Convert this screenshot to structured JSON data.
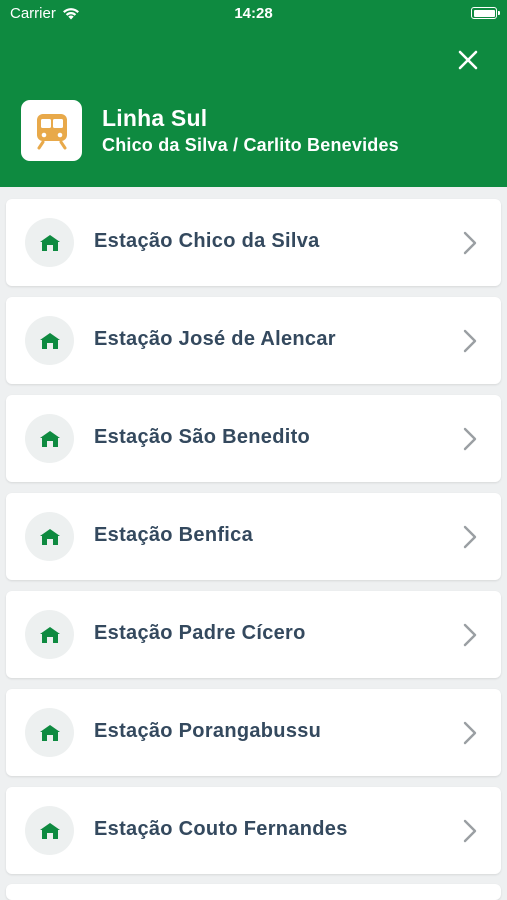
{
  "status_bar": {
    "carrier": "Carrier",
    "time": "14:28",
    "battery_level": 1.0
  },
  "header": {
    "background_color": "#0e8a40",
    "line_name": "Linha Sul",
    "route": "Chico da Silva / Carlito Benevides",
    "icon": "train-icon",
    "close_icon": "close-icon"
  },
  "stations": [
    {
      "label": "Estação Chico da Silva",
      "icon": "station-icon"
    },
    {
      "label": "Estação José de Alencar",
      "icon": "station-icon"
    },
    {
      "label": "Estação São Benedito",
      "icon": "station-icon"
    },
    {
      "label": "Estação Benfica",
      "icon": "station-icon"
    },
    {
      "label": "Estação Padre Cícero",
      "icon": "station-icon"
    },
    {
      "label": "Estação Porangabussu",
      "icon": "station-icon"
    },
    {
      "label": "Estação Couto Fernandes",
      "icon": "station-icon"
    }
  ]
}
